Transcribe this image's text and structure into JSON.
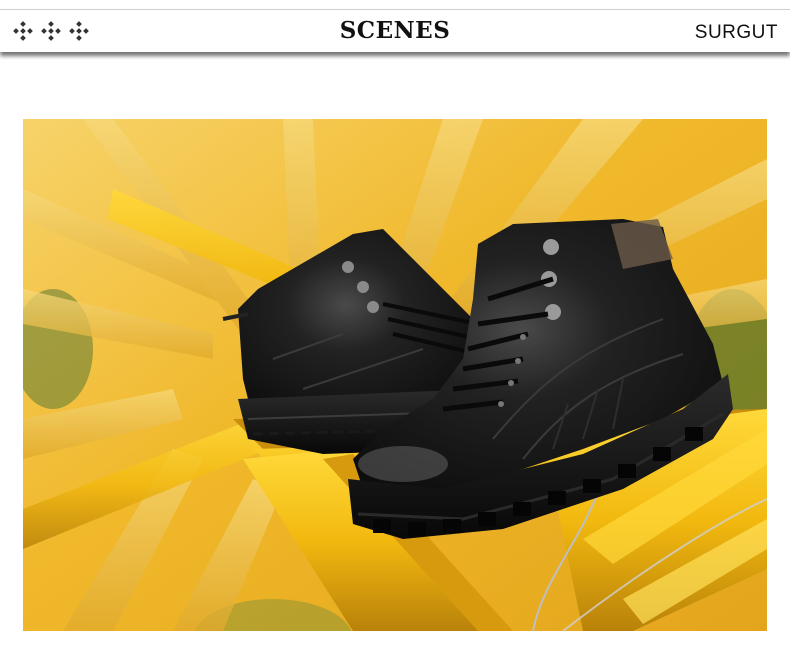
{
  "header": {
    "title": "SCENES",
    "brand": "SURGUT",
    "decoration_icon": "diamond-cluster-icon"
  },
  "photo": {
    "subject_icon": "black-leather-boots-photo",
    "colors": {
      "crane_yellow": "#f2b90f",
      "leather_black": "#151515",
      "background_green": "#3f6a2a"
    }
  }
}
